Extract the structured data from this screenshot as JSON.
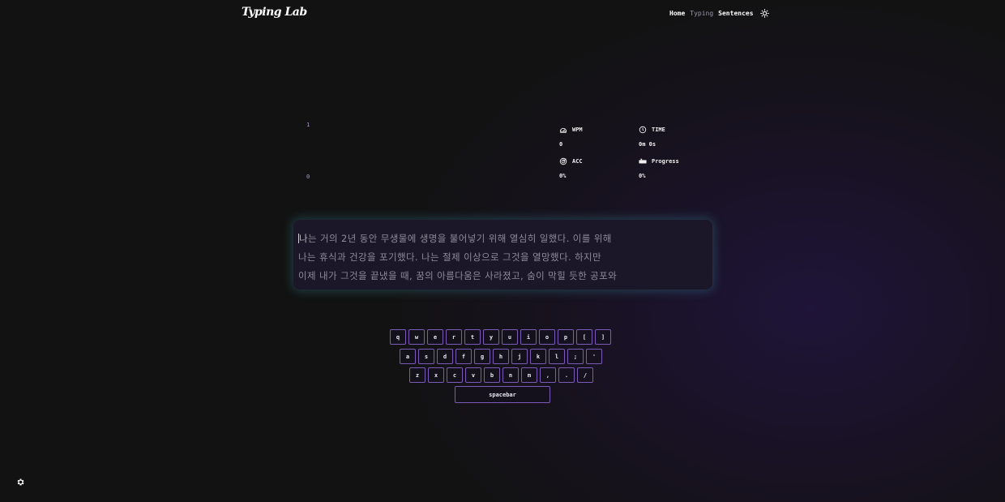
{
  "header": {
    "logo": "Typing Lab",
    "nav": [
      {
        "label": "Home"
      },
      {
        "label": "Typing"
      },
      {
        "label": "Sentences"
      }
    ],
    "theme_icon": "sun-icon"
  },
  "chart_data": {
    "type": "line",
    "y_ticks": [
      "1",
      "0"
    ],
    "ylim": [
      0,
      1
    ],
    "series": [
      {
        "values": []
      }
    ]
  },
  "stats": {
    "wpm": {
      "label": "WPM",
      "value": "0",
      "icon": "speedometer-icon"
    },
    "time": {
      "label": "TIME",
      "value": "0m 0s",
      "icon": "clock-icon"
    },
    "acc": {
      "label": "ACC",
      "value": "0%",
      "icon": "target-icon"
    },
    "progress": {
      "label": "Progress",
      "value": "0%",
      "icon": "keyboard-icon"
    }
  },
  "sentence": {
    "line1_first": "나",
    "line1_rest": "는 거의 2년 동안 무생물에 생명을 불어넣기 위해 열심히 일했다. 이를 위해",
    "line2": "나는 휴식과 건강을 포기했다. 나는 절제 이상으로 그것을 열망했다. 하지만",
    "line3": "이제 내가 그것을 끝냈을 때, 꿈의 아름다움은 사라졌고, 숨이 막힐 듯한 공포와"
  },
  "keyboard": {
    "row1": [
      "q",
      "w",
      "e",
      "r",
      "t",
      "y",
      "u",
      "i",
      "o",
      "p",
      "[",
      "]"
    ],
    "row2": [
      "a",
      "s",
      "d",
      "f",
      "g",
      "h",
      "j",
      "k",
      "l",
      ";",
      "'"
    ],
    "row3": [
      "z",
      "x",
      "c",
      "v",
      "b",
      "n",
      "m",
      ",",
      ".",
      "/"
    ],
    "spacebar": "spacebar"
  },
  "settings_icon": "gear-icon",
  "colors": {
    "accent": "#7a5cb8",
    "text_box_glow": "#3c96aa",
    "text_pending": "#8e8a98"
  }
}
